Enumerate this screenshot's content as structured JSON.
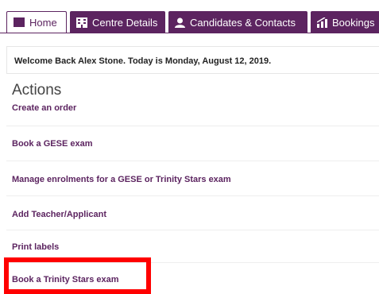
{
  "tabs": [
    {
      "label": "Home",
      "icon": "book-icon"
    },
    {
      "label": "Centre Details",
      "icon": "building-icon"
    },
    {
      "label": "Candidates & Contacts",
      "icon": "person-icon"
    },
    {
      "label": "Bookings",
      "icon": "chart-icon"
    }
  ],
  "welcome": "Welcome Back Alex Stone.  Today is Monday, August 12, 2019.",
  "actions": {
    "title": "Actions",
    "items": [
      "Create an order",
      "Book a GESE exam",
      "Manage enrolments for a GESE or Trinity Stars exam",
      "Add Teacher/Applicant",
      "Print labels",
      "Book a Trinity Stars exam"
    ]
  },
  "colors": {
    "brand": "#5c2460",
    "highlight": "#ff0000"
  }
}
